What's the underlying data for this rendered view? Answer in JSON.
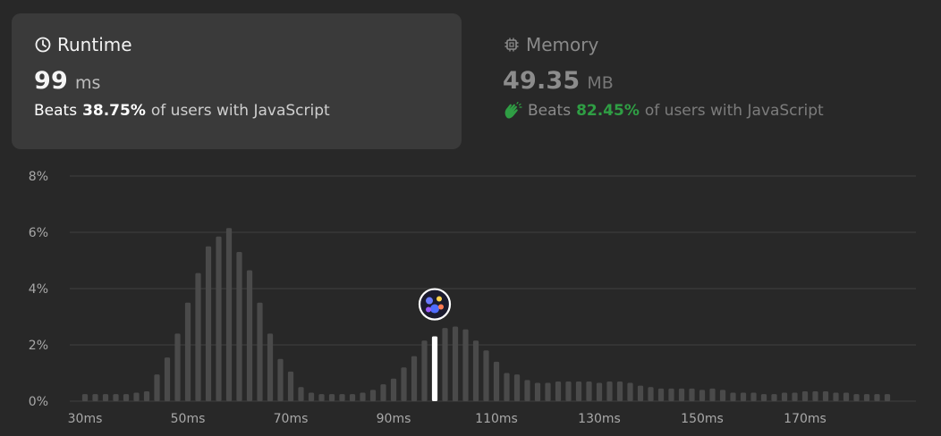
{
  "runtime": {
    "title": "Runtime",
    "icon": "clock-icon",
    "value": "99",
    "unit": "ms",
    "beats_word": "Beats",
    "beats_pct": "38.75%",
    "beats_suffix": "of users with JavaScript"
  },
  "memory": {
    "title": "Memory",
    "icon": "chip-icon",
    "value": "49.35",
    "unit": "MB",
    "beats_word": "Beats",
    "beats_pct": "82.45%",
    "beats_suffix": "of users with JavaScript",
    "accent": "#2f9e44"
  },
  "chart_data": {
    "type": "bar",
    "title": "",
    "xlabel": "",
    "ylabel": "",
    "ylim": [
      0,
      8
    ],
    "yticks": [
      "0%",
      "2%",
      "4%",
      "6%",
      "8%"
    ],
    "xticks": [
      "30ms",
      "50ms",
      "70ms",
      "90ms",
      "110ms",
      "130ms",
      "150ms",
      "170ms"
    ],
    "grid": true,
    "bar_color": "#4a4a4a",
    "highlight_color": "#ffffff",
    "highlight_value": 99,
    "marker_icon": "user-avatar",
    "x": [
      30,
      32,
      34,
      36,
      38,
      40,
      42,
      44,
      46,
      48,
      50,
      52,
      54,
      56,
      58,
      60,
      62,
      64,
      66,
      68,
      70,
      72,
      74,
      76,
      78,
      80,
      82,
      84,
      86,
      88,
      90,
      92,
      94,
      96,
      98,
      100,
      102,
      104,
      106,
      108,
      110,
      112,
      114,
      116,
      118,
      120,
      122,
      124,
      126,
      128,
      130,
      132,
      134,
      136,
      138,
      140,
      142,
      144,
      146,
      148,
      150,
      152,
      154,
      156,
      158,
      160,
      162,
      164,
      166,
      168,
      170,
      172,
      174,
      176,
      178,
      180,
      182,
      184,
      186
    ],
    "values": [
      0.25,
      0.25,
      0.25,
      0.25,
      0.25,
      0.3,
      0.35,
      0.95,
      1.55,
      2.4,
      3.5,
      4.55,
      5.5,
      5.85,
      6.15,
      5.3,
      4.65,
      3.5,
      2.4,
      1.5,
      1.05,
      0.5,
      0.3,
      0.25,
      0.25,
      0.25,
      0.25,
      0.3,
      0.4,
      0.6,
      0.8,
      1.2,
      1.6,
      2.15,
      2.3,
      2.6,
      2.65,
      2.55,
      2.15,
      1.8,
      1.4,
      1.0,
      0.95,
      0.75,
      0.65,
      0.65,
      0.7,
      0.7,
      0.7,
      0.7,
      0.65,
      0.7,
      0.7,
      0.65,
      0.55,
      0.5,
      0.45,
      0.45,
      0.45,
      0.45,
      0.4,
      0.45,
      0.4,
      0.3,
      0.3,
      0.3,
      0.25,
      0.25,
      0.3,
      0.3,
      0.35,
      0.35,
      0.35,
      0.3,
      0.3,
      0.25,
      0.25,
      0.25,
      0.25
    ]
  }
}
